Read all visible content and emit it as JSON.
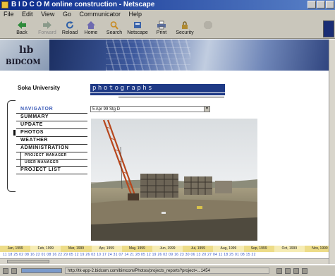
{
  "window": {
    "title": "B I D C O M online construction - Netscape"
  },
  "menu": [
    "File",
    "Edit",
    "View",
    "Go",
    "Communicator",
    "Help"
  ],
  "toolbar": [
    {
      "label": "Back",
      "icon": "back-arrow-icon"
    },
    {
      "label": "Forward",
      "icon": "forward-arrow-icon"
    },
    {
      "label": "Reload",
      "icon": "reload-icon"
    },
    {
      "label": "Home",
      "icon": "home-icon"
    },
    {
      "label": "Search",
      "icon": "search-icon"
    },
    {
      "label": "Netscape",
      "icon": "netscape-icon"
    },
    {
      "label": "Print",
      "icon": "print-icon"
    },
    {
      "label": "Security",
      "icon": "security-lock-icon"
    },
    {
      "label": "",
      "icon": "stop-icon"
    }
  ],
  "banner": {
    "logo_text": "BIDCOM"
  },
  "project": {
    "name": "Soka University"
  },
  "section": {
    "title": "photographs"
  },
  "nav": {
    "items": [
      {
        "label": "NAVIGATOR",
        "type": "head"
      },
      {
        "label": "SUMMARY",
        "type": "item"
      },
      {
        "label": "UPDATE",
        "type": "item"
      },
      {
        "label": "PHOTOS",
        "type": "active"
      },
      {
        "label": "WEATHER",
        "type": "item"
      },
      {
        "label": "ADMINISTRATION",
        "type": "item"
      },
      {
        "label": "PROJECT MANAGER",
        "type": "sub"
      },
      {
        "label": "USER MANAGER",
        "type": "sub"
      },
      {
        "label": "PROJECT LIST",
        "type": "item"
      }
    ]
  },
  "photo_select": {
    "value": "5 Apr 99 Stg D"
  },
  "timeline": {
    "months": [
      "Jan, 1999",
      "Feb, 1999",
      "Mar, 1999",
      "Apr, 1999",
      "May, 1999",
      "Jun, 1999",
      "Jul, 1999",
      "Aug, 1999",
      "Sep, 1999",
      "Oct, 1999",
      "Nov, 1999"
    ],
    "days": "11 18 25  02 08 16 22  01 08 16 22 29  05 12 19 26  03 10 17 24 31  07 14 21 28  05 12 19 26  02 09 16 23 30  06 13 20 27  04 11 18 25  01 08 15 22"
  },
  "status": {
    "url": "http://tk-app-2.bidcom.com/bimcom/Photos/projects_reports?project=...1454"
  },
  "colors": {
    "title_bar": "#0a2a8c",
    "chrome": "#c9c6bb",
    "section_bar": "#1f3a86",
    "nav_head": "#3b5bb8",
    "timeline": "#eddc88"
  }
}
